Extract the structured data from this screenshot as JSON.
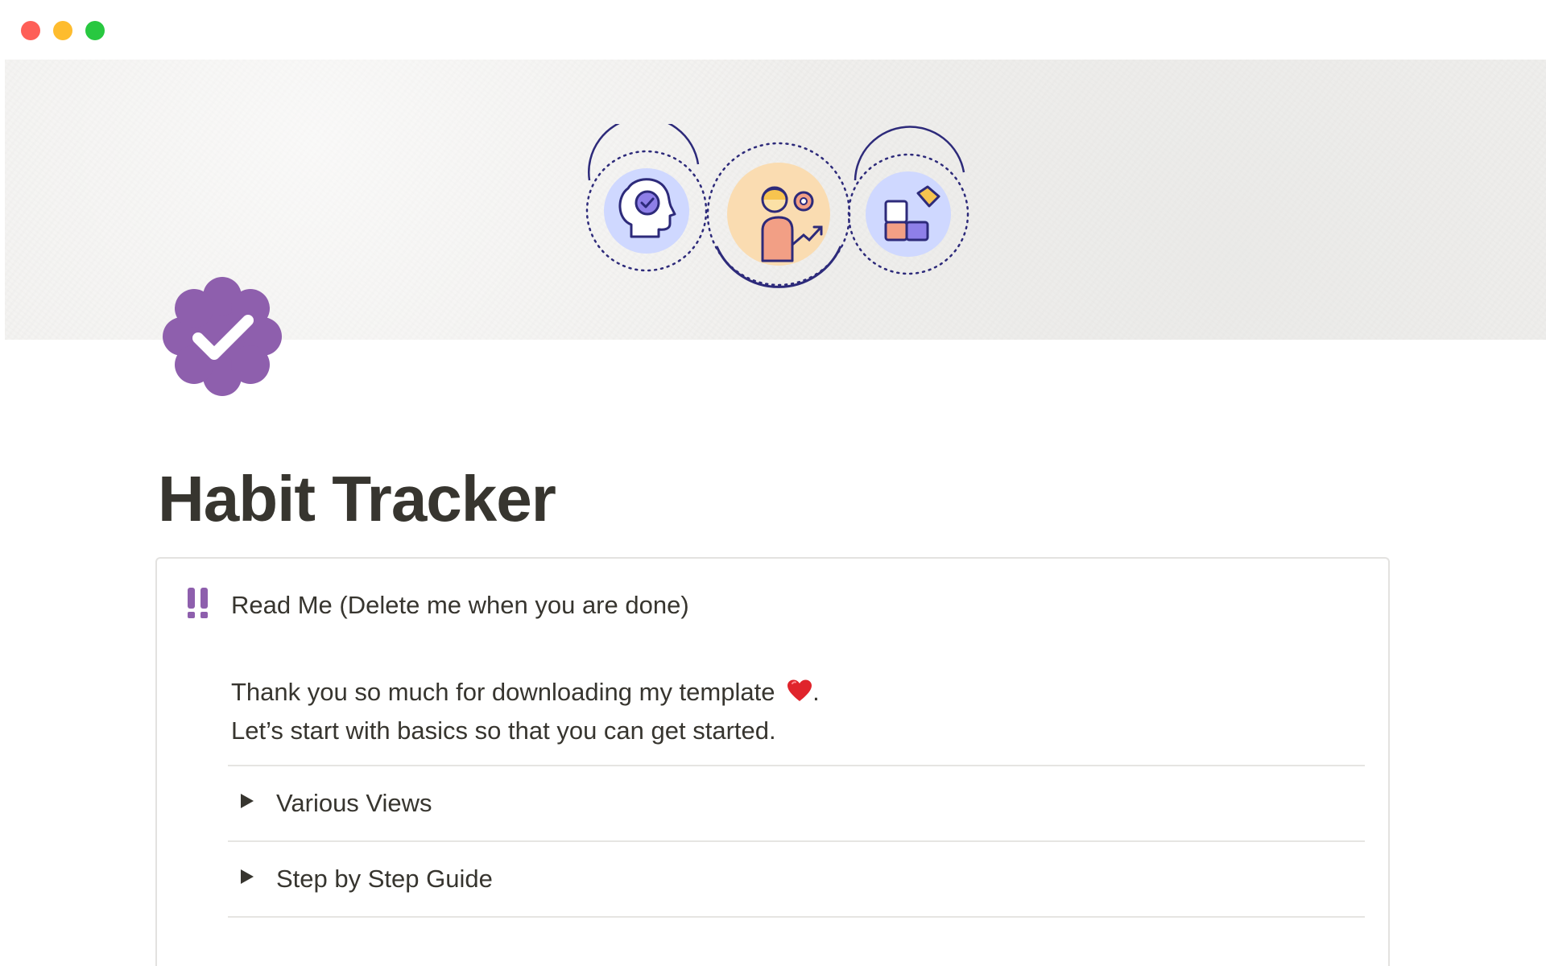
{
  "window": {
    "controls": [
      {
        "name": "close",
        "color": "#fe5f57"
      },
      {
        "name": "minimize",
        "color": "#febc2e"
      },
      {
        "name": "zoom",
        "color": "#28c840"
      }
    ]
  },
  "cover": {
    "background": "#f1f0ee",
    "icons": [
      "brain-gear-icon",
      "person-growth-icon",
      "puzzle-icon"
    ]
  },
  "page": {
    "icon": "verified-badge-icon",
    "icon_color": "#8e5fad",
    "title": "Habit Tracker"
  },
  "callout": {
    "emoji": "double-exclamation-icon",
    "emoji_color": "#8e5fad",
    "heading": "Read Me (Delete me when you are done)",
    "body_line_1": "Thank you so much for downloading my template",
    "body_line_1_end": ".",
    "body_line_2": "Let’s start with basics so that you can get started.",
    "heart_icon": "red-heart-icon"
  },
  "toggles": [
    {
      "label": "Various Views"
    },
    {
      "label": "Step by Step Guide"
    }
  ]
}
